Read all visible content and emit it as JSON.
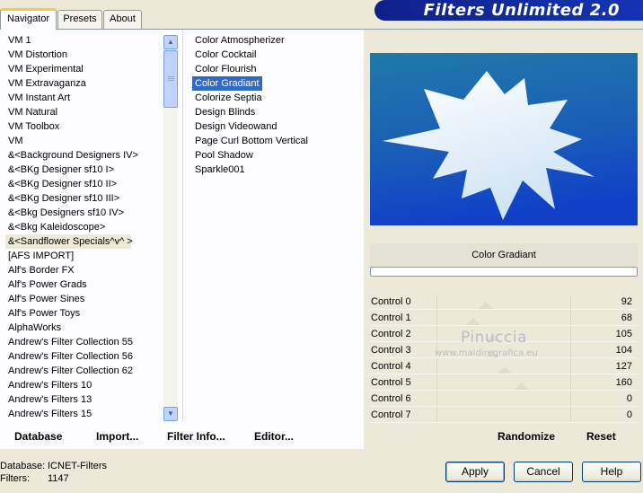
{
  "tabs": [
    {
      "label": "Navigator",
      "active": true
    },
    {
      "label": "Presets",
      "active": false
    },
    {
      "label": "About",
      "active": false
    }
  ],
  "banner": "Filters Unlimited 2.0",
  "categories": [
    "VM 1",
    "VM Distortion",
    "VM Experimental",
    "VM Extravaganza",
    "VM Instant Art",
    "VM Natural",
    "VM Toolbox",
    "VM",
    "&<Background Designers IV>",
    "&<BKg Designer sf10 I>",
    "&<BKg Designer sf10 II>",
    "&<BKg Designer sf10 III>",
    "&<Bkg Designers sf10 IV>",
    "&<Bkg Kaleidoscope>",
    "&<Sandflower Specials^v^ >",
    "[AFS IMPORT]",
    "Alf's Border FX",
    "Alf's Power Grads",
    "Alf's Power Sines",
    "Alf's Power Toys",
    "AlphaWorks",
    "Andrew's Filter Collection 55",
    "Andrew's Filter Collection 56",
    "Andrew's Filter Collection 62",
    "Andrew's Filters 10",
    "Andrew's Filters 13",
    "Andrew's Filters 15"
  ],
  "highlighted_category": "&<Sandflower Specials^v^ >",
  "filters": [
    "Color Atmospherizer",
    "Color Cocktail",
    "Color Flourish",
    "Color Gradiant",
    "Colorize Septia",
    "Design Blinds",
    "Design Videowand",
    "Page Curl Bottom Vertical",
    "Pool Shadow",
    "Sparkle001"
  ],
  "selected_filter": "Color Gradiant",
  "filter_title": "Color Gradiant",
  "controls": [
    {
      "label": "Control 0",
      "value": "92"
    },
    {
      "label": "Control 1",
      "value": "68"
    },
    {
      "label": "Control 2",
      "value": "105"
    },
    {
      "label": "Control 3",
      "value": "104"
    },
    {
      "label": "Control 4",
      "value": "127"
    },
    {
      "label": "Control 5",
      "value": "160"
    },
    {
      "label": "Control 6",
      "value": "0"
    },
    {
      "label": "Control 7",
      "value": "0"
    }
  ],
  "watermark": {
    "name": "Pinuccia",
    "url": "www.maidiregrafica.eu"
  },
  "actions": {
    "database": "Database",
    "import": "Import...",
    "filter_info": "Filter Info...",
    "editor": "Editor...",
    "randomize": "Randomize",
    "reset": "Reset"
  },
  "status": {
    "database_label": "Database:",
    "database_value": "ICNET-Filters",
    "filters_label": "Filters:",
    "filters_value": "1147"
  },
  "buttons": {
    "apply": "Apply",
    "cancel": "Cancel",
    "help": "Help"
  },
  "colors": {
    "selection": "#316ac5",
    "banner": "#10208a",
    "preview_top": "#1f7aa8",
    "preview_bottom": "#1040c8"
  }
}
